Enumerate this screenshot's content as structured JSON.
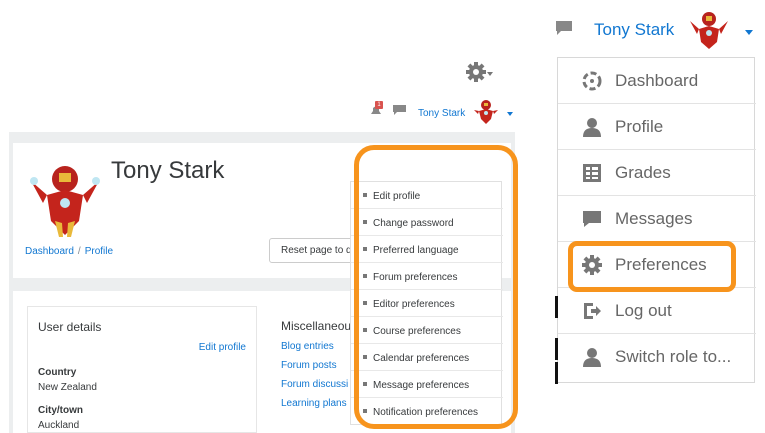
{
  "profile_page": {
    "navbar": {
      "notification_count": "1",
      "user_name": "Tony Stark"
    },
    "header": {
      "name": "Tony Stark",
      "breadcrumb": [
        "Dashboard",
        "Profile"
      ],
      "breadcrumb_separator": "/",
      "reset_button": "Reset page to d"
    },
    "user_details": {
      "title": "User details",
      "edit_link": "Edit profile",
      "fields": [
        {
          "label": "Country",
          "value": "New Zealand"
        },
        {
          "label": "City/town",
          "value": "Auckland"
        }
      ]
    },
    "miscellaneous": {
      "title": "Miscellaneou",
      "links": [
        "Blog entries",
        "Forum posts",
        "Forum discussi",
        "Learning plans"
      ]
    },
    "gear_menu": {
      "icon": "gear-icon",
      "items": [
        "Edit profile",
        "Change password",
        "Preferred language",
        "Forum preferences",
        "Editor preferences",
        "Course preferences",
        "Calendar preferences",
        "Message preferences",
        "Notification preferences"
      ]
    }
  },
  "user_menu": {
    "user_name": "Tony Stark",
    "items": [
      {
        "label": "Dashboard",
        "icon": "dashboard-icon"
      },
      {
        "label": "Profile",
        "icon": "user-icon"
      },
      {
        "label": "Grades",
        "icon": "grades-icon"
      },
      {
        "label": "Messages",
        "icon": "messages-icon"
      },
      {
        "label": "Preferences",
        "icon": "gear-icon"
      },
      {
        "label": "Log out",
        "icon": "logout-icon"
      },
      {
        "label": "Switch role to...",
        "icon": "user-icon"
      }
    ]
  },
  "colors": {
    "link": "#1177d1",
    "highlight": "#f7941d",
    "page_bg": "#eceeef",
    "icon_grey": "#777777"
  }
}
